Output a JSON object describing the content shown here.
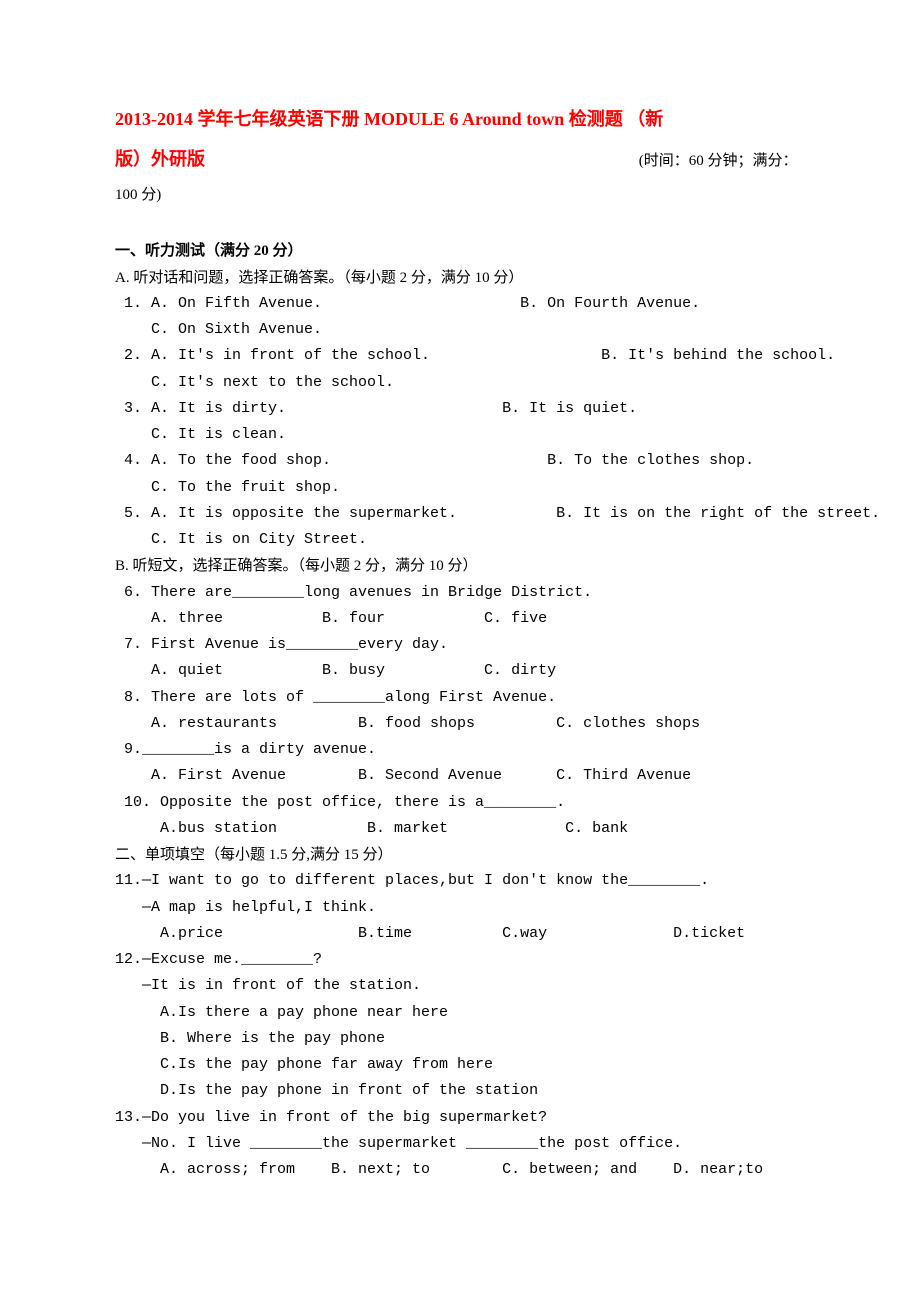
{
  "title_part1": "2013-2014 学年七年级英语下册 MODULE 6 Around town 检测题 （新",
  "title_part2": "版）外研版",
  "meta_time": "(时间：60 分钟；满分：100 分)",
  "sec1_header": "一、听力测试（满分 20 分）",
  "sec1_a": "A. 听对话和问题，选择正确答案。（每小题 2 分，满分 10 分）",
  "q1a": " 1. A. On Fifth Avenue.                      B. On Fourth Avenue.",
  "q1c": "    C. On Sixth Avenue.",
  "q2a": " 2. A. It's in front of the school.                   B. It's behind the school.",
  "q2c": "    C. It's next to the school.",
  "q3a": " 3. A. It is dirty.                        B. It is quiet.",
  "q3c": "    C. It is clean.",
  "q4a": " 4. A. To the food shop.                        B. To the clothes shop.",
  "q4c": "    C. To the fruit shop.",
  "q5a": " 5. A. It is opposite the supermarket.           B. It is on the right of the street.",
  "q5c": "    C. It is on City Street.",
  "sec1_b": " B. 听短文，选择正确答案。（每小题 2 分，满分 10 分）",
  "q6": " 6. There are________long avenues in Bridge District.",
  "q6opts": "    A. three           B. four           C. five",
  "q7": " 7. First Avenue is________every day.",
  "q7opts": "    A. quiet           B. busy           C. dirty",
  "q8": " 8. There are lots of ________along First Avenue.",
  "q8opts": "    A. restaurants         B. food shops         C. clothes shops",
  "q9": " 9.________is a dirty avenue.",
  "q9opts": "    A. First Avenue        B. Second Avenue      C. Third Avenue",
  "q10": " 10. Opposite the post office, there is a________.",
  "q10opts": "     A.bus station          B. market             C. bank",
  "sec2_header": "二、单项填空（每小题 1.5 分,满分 15 分）",
  "q11a": "11.—I want to go to different places,but I don't know the________.",
  "q11b": "   —A map is helpful,I think.",
  "q11opts": "     A.price               B.time          C.way              D.ticket",
  "q12a": "12.—Excuse me.________?",
  "q12b": "   —It is in front of the station.",
  "q12o1": "     A.Is there a pay phone near here",
  "q12o2": "     B. Where is the pay phone",
  "q12o3": "     C.Is the pay phone far away from here",
  "q12o4": "     D.Is the pay phone in front of the station",
  "q13a": "13.—Do you live in front of the big supermarket?",
  "q13b": "   —No. I live ________the supermarket ________the post office.",
  "q13opts": "     A. across; from    B. next; to        C. between; and    D. near;to"
}
